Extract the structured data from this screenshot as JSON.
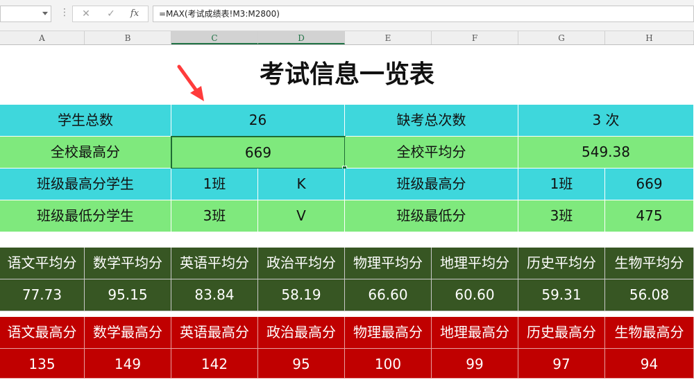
{
  "formula_bar": {
    "name_box": "",
    "cancel_icon": "✕",
    "enter_icon": "✓",
    "fx_label": "fx",
    "formula": "=MAX(考试成绩表!M3:M2800)"
  },
  "columns": [
    "A",
    "B",
    "C",
    "D",
    "E",
    "F",
    "G",
    "H"
  ],
  "title": "考试信息一览表",
  "summary": {
    "r1": {
      "label1": "学生总数",
      "value1": "26",
      "label2": "缺考总次数",
      "value2": "3 次"
    },
    "r2": {
      "label1": "全校最高分",
      "value1": "669",
      "label2": "全校平均分",
      "value2": "549.38"
    },
    "r3": {
      "label1": "班级最高分学生",
      "class1": "1班",
      "student1": "K",
      "label2": "班级最高分",
      "class2": "1班",
      "score2": "669"
    },
    "r4": {
      "label1": "班级最低分学生",
      "class1": "3班",
      "student1": "V",
      "label2": "班级最低分",
      "class2": "3班",
      "score2": "475"
    }
  },
  "averages": {
    "headers": [
      "语文平均分",
      "数学平均分",
      "英语平均分",
      "政治平均分",
      "物理平均分",
      "地理平均分",
      "历史平均分",
      "生物平均分"
    ],
    "values": [
      "77.73",
      "95.15",
      "83.84",
      "58.19",
      "66.60",
      "60.60",
      "59.31",
      "56.08"
    ]
  },
  "maxes": {
    "headers": [
      "语文最高分",
      "数学最高分",
      "英语最高分",
      "政治最高分",
      "物理最高分",
      "地理最高分",
      "历史最高分",
      "生物最高分"
    ],
    "values": [
      "135",
      "149",
      "142",
      "95",
      "100",
      "99",
      "97",
      "94"
    ]
  },
  "colors": {
    "cyan": "#3ed7dc",
    "light_green": "#7fe97d",
    "dark_green": "#375623",
    "red": "#c00000",
    "arrow": "#ff3b3b"
  }
}
